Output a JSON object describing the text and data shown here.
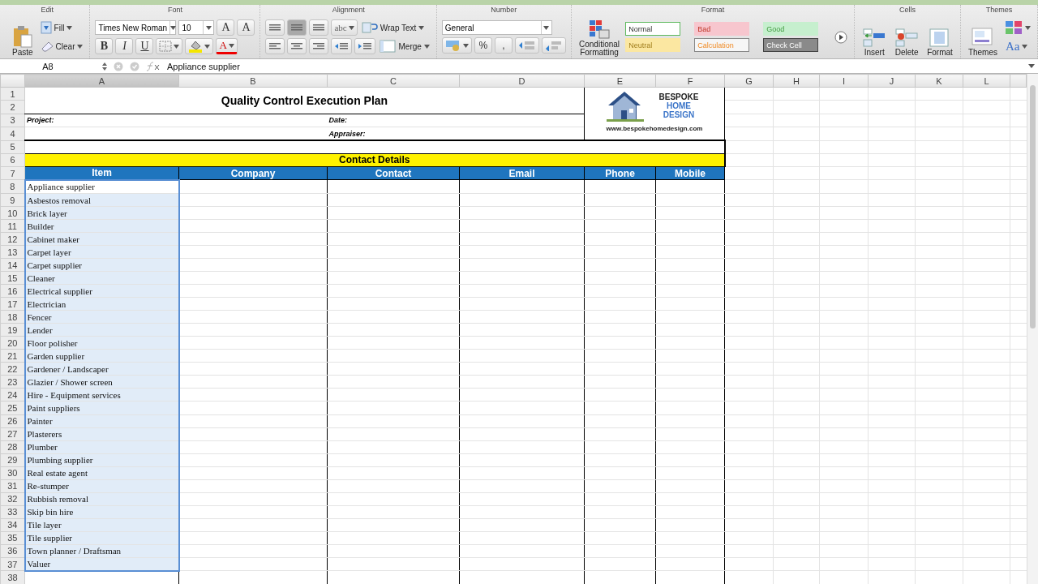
{
  "ribbon": {
    "groups": [
      {
        "label": "Edit",
        "lead": [
          {
            "kind": "paste",
            "label": "Paste"
          }
        ],
        "top_row": [
          {
            "kind": "fill",
            "label": "Fill"
          }
        ],
        "bottom_row": [
          {
            "kind": "clear",
            "label": "Clear"
          }
        ]
      },
      {
        "label": "Font",
        "top_row": [
          {
            "kind": "font-field",
            "value": "Times New Roman"
          },
          {
            "kind": "size-field",
            "value": "10"
          },
          {
            "kind": "grow",
            "label": "A"
          },
          {
            "kind": "shrink",
            "label": "A"
          }
        ],
        "bottom_row": [
          {
            "kind": "bold",
            "label": "B"
          },
          {
            "kind": "italic",
            "label": "I"
          },
          {
            "kind": "underline",
            "label": "U"
          },
          {
            "kind": "borders"
          },
          {
            "kind": "fill-color"
          },
          {
            "kind": "font-color",
            "label": "A"
          }
        ]
      },
      {
        "label": "Alignment",
        "top_row": [
          {
            "kind": "align-top",
            "selected": false
          },
          {
            "kind": "align-middle",
            "selected": true
          },
          {
            "kind": "align-bottom",
            "selected": false
          },
          {
            "kind": "orient",
            "label": "abc"
          },
          {
            "kind": "wrap",
            "label": "Wrap Text"
          }
        ],
        "bottom_row": [
          {
            "kind": "align-left",
            "selected": false
          },
          {
            "kind": "align-center",
            "selected": false
          },
          {
            "kind": "align-right",
            "selected": false
          },
          {
            "kind": "outdent"
          },
          {
            "kind": "indent"
          },
          {
            "kind": "merge",
            "label": "Merge"
          }
        ]
      },
      {
        "label": "Number",
        "top_row": [
          {
            "kind": "number-format",
            "value": "General"
          }
        ],
        "bottom_row": [
          {
            "kind": "currency"
          },
          {
            "kind": "percent",
            "label": "%"
          },
          {
            "kind": "comma",
            "label": ","
          },
          {
            "kind": "more-decimals"
          },
          {
            "kind": "less-decimals"
          }
        ]
      },
      {
        "label": "Format",
        "lead": [
          {
            "kind": "conditional",
            "label": "Conditional Formatting"
          }
        ],
        "top_row": [
          {
            "kind": "normal-style",
            "label": "Normal",
            "color": "#ffffff"
          },
          {
            "kind": "bad-style",
            "label": "Bad",
            "color": "#f7c6ce"
          },
          {
            "kind": "good-style",
            "label": "Good",
            "color": "#c6efce"
          }
        ],
        "bottom_row": [
          {
            "kind": "neutral-style",
            "label": "Neutral",
            "color": "#fbe7a1"
          },
          {
            "kind": "calculation-style",
            "label": "Calculation",
            "color": "#f6f6f6"
          },
          {
            "kind": "check-style",
            "label": "Check Cell",
            "color": "#8a8a8a"
          }
        ],
        "tail": [
          {
            "kind": "more"
          }
        ]
      },
      {
        "label": "Cells",
        "lead": [
          {
            "kind": "insert",
            "label": "Insert"
          },
          {
            "kind": "delete",
            "label": "Delete"
          },
          {
            "kind": "format",
            "label": "Format"
          }
        ]
      },
      {
        "label": "Themes",
        "lead": [
          {
            "kind": "themes",
            "label": "Themes"
          }
        ],
        "top_row": [
          {
            "kind": "theme-colors"
          }
        ],
        "bottom_row": [
          {
            "kind": "theme-fonts",
            "label": "Aa"
          }
        ]
      }
    ]
  },
  "formula_bar": {
    "name_box": "A8",
    "formula": "Appliance supplier"
  },
  "sheet": {
    "columns": [
      {
        "label": "A",
        "selected": true
      },
      {
        "label": "B",
        "selected": false
      },
      {
        "label": "C",
        "selected": false
      },
      {
        "label": "D",
        "selected": false
      },
      {
        "label": "E",
        "selected": false
      },
      {
        "label": "F",
        "selected": false
      },
      {
        "label": "G",
        "selected": false
      },
      {
        "label": "H",
        "selected": false
      },
      {
        "label": "I",
        "selected": false
      },
      {
        "label": "J",
        "selected": false
      },
      {
        "label": "K",
        "selected": false
      },
      {
        "label": "L",
        "selected": false
      }
    ],
    "row_headers": [
      "1",
      "2",
      "3",
      "4",
      "5",
      "6",
      "7",
      "8",
      "9",
      "10",
      "11",
      "12",
      "13",
      "14",
      "15",
      "16",
      "17",
      "18",
      "19",
      "20",
      "21",
      "22",
      "23",
      "24",
      "25",
      "26",
      "27",
      "28",
      "29",
      "30",
      "31",
      "32",
      "33",
      "34",
      "35",
      "36",
      "37",
      "38"
    ],
    "title": "Quality Control Execution Plan",
    "project_label": "Project:",
    "date_label": "Date:",
    "appraiser_label": "Appraiser:",
    "logo": {
      "line1": "BESPOKE",
      "line2": "HOME",
      "line3": "DESIGN",
      "url": "www.bespokehomedesign.com"
    },
    "section": "Contact Details",
    "headers": [
      "Item",
      "Company",
      "Contact",
      "Email",
      "Phone",
      "Mobile"
    ],
    "items": [
      {
        "text": "Appliance supplier",
        "selected": true,
        "active": true
      },
      {
        "text": "Asbestos removal",
        "selected": true,
        "active": false
      },
      {
        "text": "Brick layer",
        "selected": true,
        "active": false
      },
      {
        "text": "Builder",
        "selected": true,
        "active": false
      },
      {
        "text": "Cabinet maker",
        "selected": true,
        "active": false
      },
      {
        "text": "Carpet layer",
        "selected": true,
        "active": false
      },
      {
        "text": "Carpet supplier",
        "selected": true,
        "active": false
      },
      {
        "text": "Cleaner",
        "selected": true,
        "active": false
      },
      {
        "text": "Electrical supplier",
        "selected": true,
        "active": false
      },
      {
        "text": "Electrician",
        "selected": true,
        "active": false
      },
      {
        "text": "Fencer",
        "selected": true,
        "active": false
      },
      {
        "text": "Lender",
        "selected": true,
        "active": false
      },
      {
        "text": "Floor polisher",
        "selected": true,
        "active": false
      },
      {
        "text": "Garden supplier",
        "selected": true,
        "active": false
      },
      {
        "text": "Gardener / Landscaper",
        "selected": true,
        "active": false
      },
      {
        "text": "Glazier / Shower screen",
        "selected": true,
        "active": false
      },
      {
        "text": "Hire - Equipment services",
        "selected": true,
        "active": false
      },
      {
        "text": "Paint suppliers",
        "selected": true,
        "active": false
      },
      {
        "text": "Painter",
        "selected": true,
        "active": false
      },
      {
        "text": "Plasterers",
        "selected": true,
        "active": false
      },
      {
        "text": "Plumber",
        "selected": true,
        "active": false
      },
      {
        "text": "Plumbing supplier",
        "selected": true,
        "active": false
      },
      {
        "text": "Real estate agent",
        "selected": true,
        "active": false
      },
      {
        "text": "Re-stumper",
        "selected": true,
        "active": false
      },
      {
        "text": "Rubbish removal",
        "selected": true,
        "active": false
      },
      {
        "text": "Skip bin hire",
        "selected": true,
        "active": false
      },
      {
        "text": "Tile layer",
        "selected": true,
        "active": false
      },
      {
        "text": "Tile supplier",
        "selected": true,
        "active": false
      },
      {
        "text": "Town planner / Draftsman",
        "selected": true,
        "active": false
      },
      {
        "text": "Valuer",
        "selected": true,
        "active": false
      }
    ]
  }
}
